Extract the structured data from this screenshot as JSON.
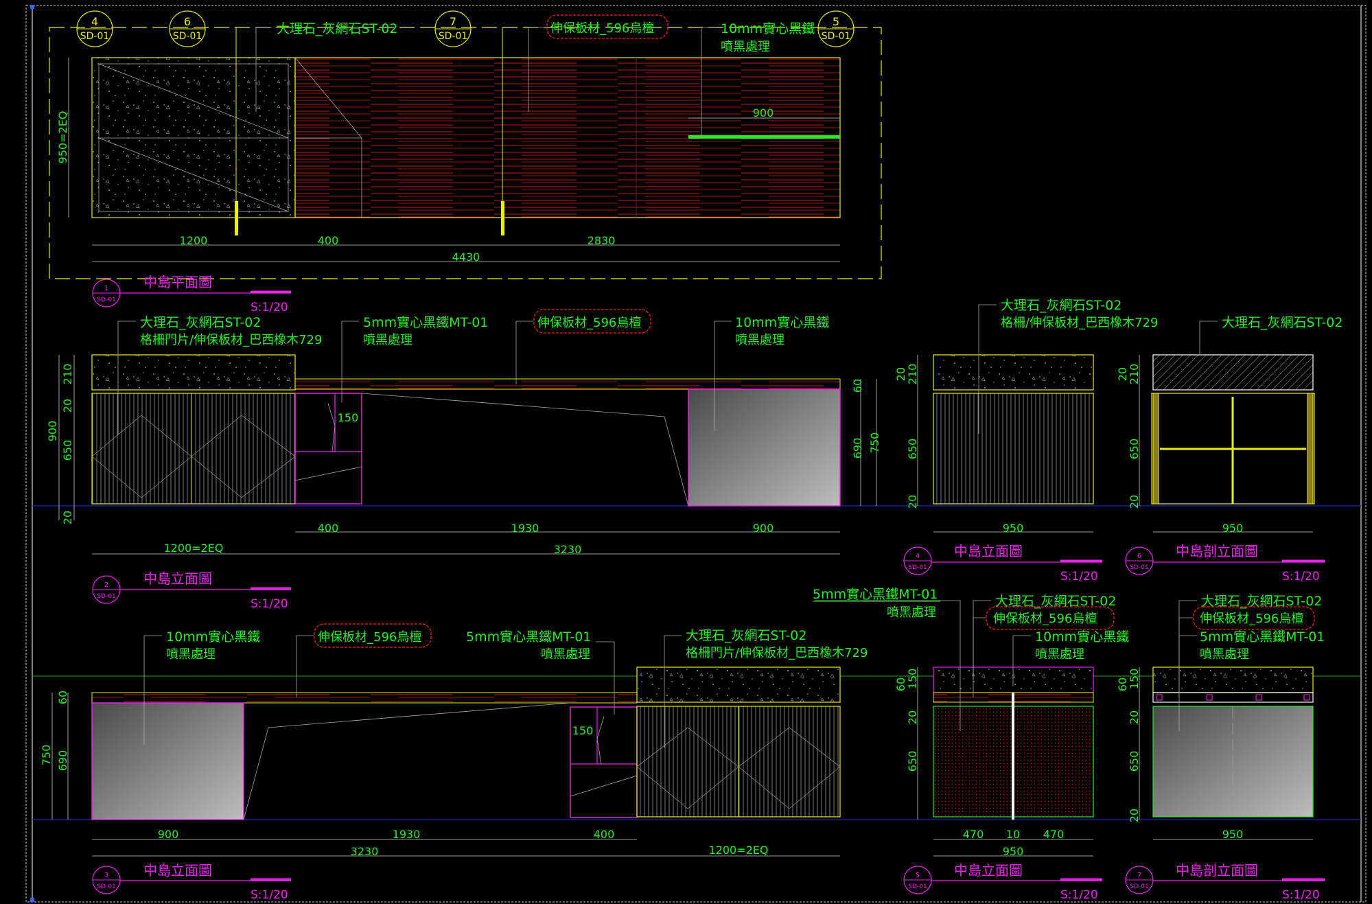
{
  "colors": {
    "background": "#000000",
    "green": "#22ee22",
    "yellow": "#eeee00",
    "magenta": "#ee22ee",
    "red": "#ee2222",
    "blue": "#2222cc",
    "white": "#ffffff",
    "frame": "#cccccc"
  },
  "callouts": {
    "c4": {
      "num": "4",
      "sheet": "SD-01"
    },
    "c6": {
      "num": "6",
      "sheet": "SD-01"
    },
    "c7": {
      "num": "7",
      "sheet": "SD-01"
    },
    "c5": {
      "num": "5",
      "sheet": "SD-01"
    }
  },
  "plan": {
    "title": "中島平面圖",
    "scale": "S:1/20",
    "tag_num": "1",
    "tag_sheet": "SD-01",
    "label_marble": "大理石_灰網石ST-02",
    "label_board": "伸保板材_596烏檀",
    "label_iron_1": "10mm實心黑鐵",
    "label_iron_2": "噴黑處理",
    "dim_height": "950=2EQ",
    "dim_900": "900",
    "dim_1200": "1200",
    "dim_400": "400",
    "dim_2830": "2830",
    "dim_4430": "4430"
  },
  "elev2": {
    "title": "中島立面圖",
    "scale": "S:1/20",
    "tag_num": "2",
    "tag_sheet": "SD-01",
    "label_marble": "大理石_灰網石ST-02",
    "label_grille": "格柵門片/伸保板材_巴西橡木729",
    "label_iron5_1": "5mm實心黑鐵MT-01",
    "label_iron5_2": "噴黑處理",
    "label_board": "伸保板材_596烏檀",
    "label_iron10_1": "10mm實心黑鐵",
    "label_iron10_2": "噴黑處理",
    "dim_210": "210",
    "dim_20a": "20",
    "dim_900": "900",
    "dim_650": "650",
    "dim_20b": "20",
    "dim_150": "150",
    "dim_60": "60",
    "dim_690": "690",
    "dim_750": "750",
    "dim_400": "400",
    "dim_1930": "1930",
    "dim_900b": "900",
    "dim_1200eq": "1200=2EQ",
    "dim_3230": "3230"
  },
  "elev3": {
    "title": "中島立面圖",
    "scale": "S:1/20",
    "tag_num": "3",
    "tag_sheet": "SD-01",
    "label_iron10_1": "10mm實心黑鐵",
    "label_iron10_2": "噴黑處理",
    "label_board": "伸保板材_596烏檀",
    "label_iron5_1": "5mm實心黑鐵MT-01",
    "label_iron5_2": "噴黑處理",
    "label_marble": "大理石_灰網石ST-02",
    "label_grille": "格柵門片/伸保板材_巴西橡木729",
    "dim_60": "60",
    "dim_750": "750",
    "dim_690": "690",
    "dim_150": "150",
    "dim_900": "900",
    "dim_1930": "1930",
    "dim_400": "400",
    "dim_3230": "3230",
    "dim_1200eq": "1200=2EQ"
  },
  "elev4": {
    "title": "中島立面圖",
    "scale": "S:1/20",
    "tag_num": "4",
    "tag_sheet": "SD-01",
    "label_marble": "大理石_灰網石ST-02",
    "label_grille": "格柵/伸保板材_巴西橡木729",
    "dim_20a": "20",
    "dim_210": "210",
    "dim_650": "650",
    "dim_20b": "20",
    "dim_950": "950"
  },
  "sec6": {
    "title": "中島剖立面圖",
    "scale": "S:1/20",
    "tag_num": "6",
    "tag_sheet": "SD-01",
    "label_marble": "大理石_灰網石ST-02",
    "dim_20a": "20",
    "dim_210": "210",
    "dim_650": "650",
    "dim_20b": "20",
    "dim_950": "950"
  },
  "elev5": {
    "title": "中島立面圖",
    "scale": "S:1/20",
    "tag_num": "5",
    "tag_sheet": "SD-01",
    "label_iron5_1": "5mm實心黑鐵MT-01",
    "label_iron5_2": "噴黑處理",
    "label_marble": "大理石_灰網石ST-02",
    "label_board": "伸保板材_596烏檀",
    "label_iron10_1": "10mm實心黑鐵",
    "label_iron10_2": "噴黑處理",
    "dim_60": "60",
    "dim_150": "150",
    "dim_20a": "20",
    "dim_650": "650",
    "dim_20b": "20",
    "dim_470a": "470",
    "dim_10": "10",
    "dim_470b": "470",
    "dim_950": "950"
  },
  "sec7": {
    "title": "中島剖立面圖",
    "scale": "S:1/20",
    "tag_num": "7",
    "tag_sheet": "SD-01",
    "label_marble": "大理石_灰網石ST-02",
    "label_board": "伸保板材_596烏檀",
    "label_iron5_1": "5mm實心黑鐵MT-01",
    "label_iron5_2": "噴黑處理",
    "dim_60": "60",
    "dim_150": "150",
    "dim_20a": "20",
    "dim_650": "650",
    "dim_20b": "20",
    "dim_950": "950"
  }
}
